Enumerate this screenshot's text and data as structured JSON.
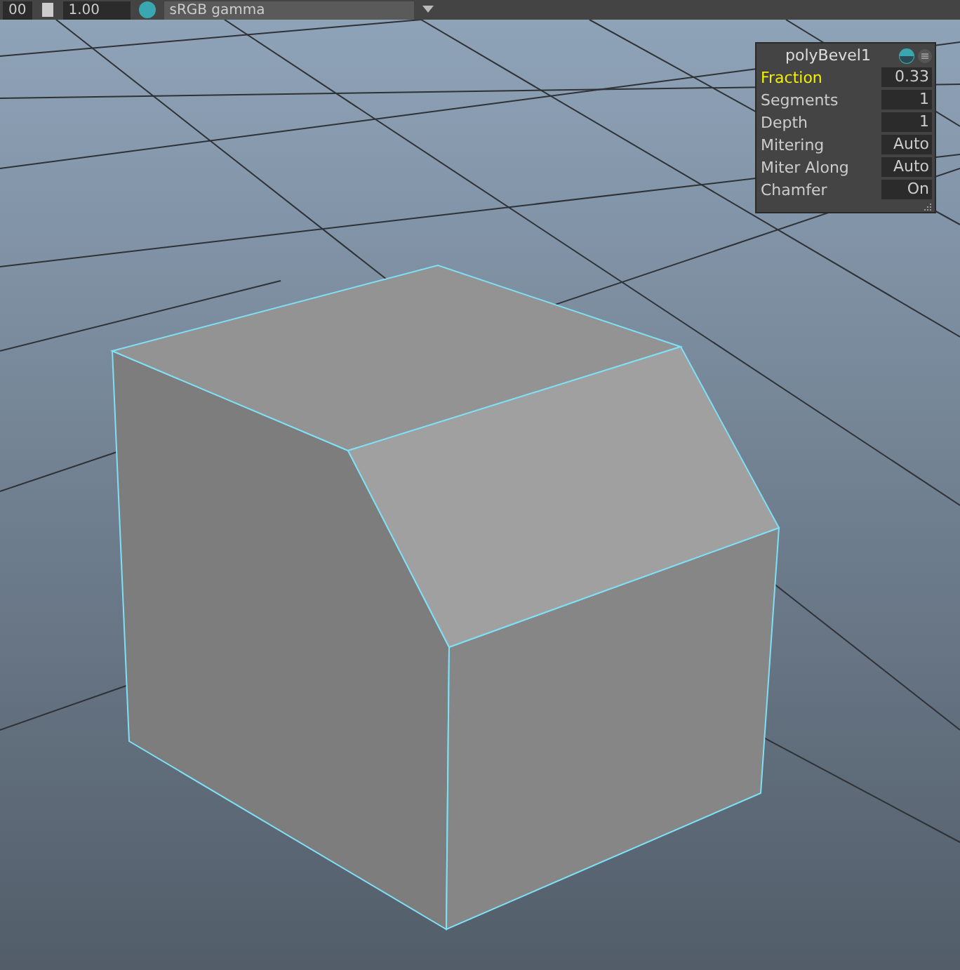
{
  "toolbar": {
    "fields": [
      "00",
      "1.00"
    ],
    "color_space": "sRGB gamma"
  },
  "hud": {
    "title": "polyBevel1",
    "rows": [
      {
        "label": "Fraction",
        "value": "0.33",
        "selected": true
      },
      {
        "label": "Segments",
        "value": "1",
        "selected": false
      },
      {
        "label": "Depth",
        "value": "1",
        "selected": false
      },
      {
        "label": "Mitering",
        "value": "Auto",
        "selected": false
      },
      {
        "label": "Miter Along",
        "value": "Auto",
        "selected": false
      },
      {
        "label": "Chamfer",
        "value": "On",
        "selected": false
      }
    ]
  }
}
